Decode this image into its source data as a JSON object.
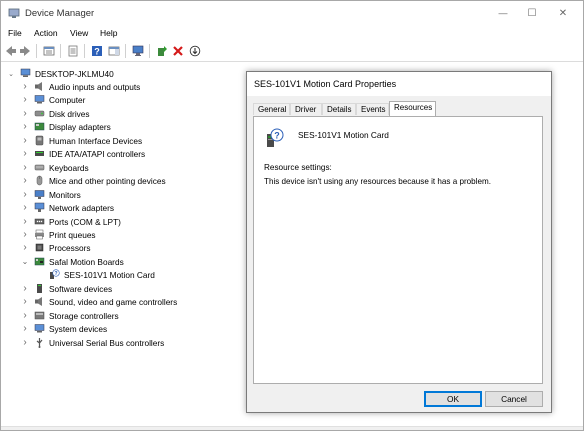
{
  "window": {
    "title": "Device Manager",
    "controls": {
      "minimize": "—",
      "maximize": "☐",
      "close": "✕"
    }
  },
  "menubar": {
    "items": [
      "File",
      "Action",
      "View",
      "Help"
    ]
  },
  "toolbar": {
    "icons": [
      "back-icon",
      "forward-icon",
      "show-hide-tree-icon",
      "properties-icon",
      "help-icon",
      "action-pane-icon",
      "monitor-icon",
      "update-driver-icon",
      "uninstall-icon",
      "scan-hardware-icon"
    ]
  },
  "tree": {
    "root": "DESKTOP-JKLMU40",
    "items": [
      {
        "label": "Audio inputs and outputs",
        "icon": "speaker-icon",
        "expanded": false
      },
      {
        "label": "Computer",
        "icon": "computer-icon",
        "expanded": false
      },
      {
        "label": "Disk drives",
        "icon": "disk-icon",
        "expanded": false
      },
      {
        "label": "Display adapters",
        "icon": "display-adapter-icon",
        "expanded": false
      },
      {
        "label": "Human Interface Devices",
        "icon": "hid-icon",
        "expanded": false
      },
      {
        "label": "IDE ATA/ATAPI controllers",
        "icon": "ide-icon",
        "expanded": false
      },
      {
        "label": "Keyboards",
        "icon": "keyboard-icon",
        "expanded": false
      },
      {
        "label": "Mice and other pointing devices",
        "icon": "mouse-icon",
        "expanded": false
      },
      {
        "label": "Monitors",
        "icon": "monitor-icon",
        "expanded": false
      },
      {
        "label": "Network adapters",
        "icon": "network-icon",
        "expanded": false
      },
      {
        "label": "Ports (COM & LPT)",
        "icon": "port-icon",
        "expanded": false
      },
      {
        "label": "Print queues",
        "icon": "printer-icon",
        "expanded": false
      },
      {
        "label": "Processors",
        "icon": "processor-icon",
        "expanded": false
      },
      {
        "label": "Safal Motion Boards",
        "icon": "board-icon",
        "expanded": true
      },
      {
        "label": "SES-101V1 Motion Card",
        "icon": "device-warning-icon",
        "child": true
      },
      {
        "label": "Software devices",
        "icon": "software-device-icon",
        "expanded": false
      },
      {
        "label": "Sound, video and game controllers",
        "icon": "sound-icon",
        "expanded": false
      },
      {
        "label": "Storage controllers",
        "icon": "storage-icon",
        "expanded": false
      },
      {
        "label": "System devices",
        "icon": "system-icon",
        "expanded": false
      },
      {
        "label": "Universal Serial Bus controllers",
        "icon": "usb-icon",
        "expanded": false
      }
    ]
  },
  "dialog": {
    "title": "SES-101V1 Motion Card Properties",
    "tabs": [
      "General",
      "Driver",
      "Details",
      "Events",
      "Resources"
    ],
    "active_tab": "Resources",
    "device_name": "SES-101V1 Motion Card",
    "resource_label": "Resource settings:",
    "resource_message": "This device isn't using any resources because it has a problem.",
    "ok_label": "OK",
    "cancel_label": "Cancel"
  }
}
